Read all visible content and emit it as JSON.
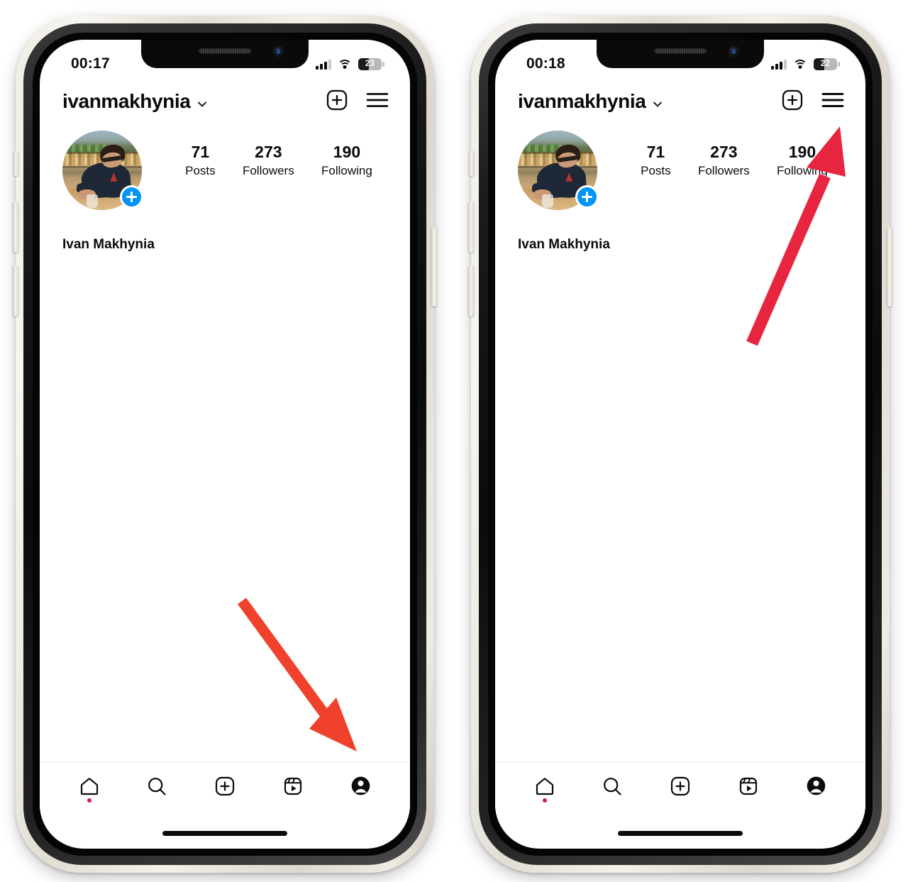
{
  "meta": {
    "app": "Instagram",
    "screens": 2,
    "accent_blue": "#0095f6",
    "arrow_color_left": "#f0412c",
    "arrow_color_right": "#e8253f",
    "badge_red": "#d81b43"
  },
  "phones": [
    {
      "id": "phone-left",
      "status": {
        "clock": "00:17",
        "cellular": "cellular-signal-icon",
        "wifi": "wifi-icon",
        "battery_percent": "23",
        "battery_icon": "battery-icon"
      },
      "header": {
        "username": "ivanmakhynia",
        "chevron": "chevron-down-icon",
        "add_icon": "plus-square-icon",
        "menu_icon": "hamburger-menu-icon"
      },
      "profile": {
        "avatar": "profile-photo",
        "add_story_badge": "plus-circle-icon",
        "full_name": "Ivan Makhynia",
        "stats": [
          {
            "num": "71",
            "label": "Posts"
          },
          {
            "num": "273",
            "label": "Followers"
          },
          {
            "num": "190",
            "label": "Following"
          }
        ]
      },
      "tabbar": [
        {
          "name": "tab-home",
          "icon": "home-icon",
          "badge": true
        },
        {
          "name": "tab-search",
          "icon": "search-icon",
          "badge": false
        },
        {
          "name": "tab-create",
          "icon": "plus-square-icon",
          "badge": false
        },
        {
          "name": "tab-reels",
          "icon": "reels-icon",
          "badge": false
        },
        {
          "name": "tab-profile",
          "icon": "profile-avatar-icon",
          "badge": false
        }
      ],
      "annotation": {
        "type": "arrow",
        "points_to": "tab-profile",
        "color": "#f0412c"
      }
    },
    {
      "id": "phone-right",
      "status": {
        "clock": "00:18",
        "cellular": "cellular-signal-icon",
        "wifi": "wifi-icon",
        "battery_percent": "22",
        "battery_icon": "battery-icon"
      },
      "header": {
        "username": "ivanmakhynia",
        "chevron": "chevron-down-icon",
        "add_icon": "plus-square-icon",
        "menu_icon": "hamburger-menu-icon"
      },
      "profile": {
        "avatar": "profile-photo",
        "add_story_badge": "plus-circle-icon",
        "full_name": "Ivan Makhynia",
        "stats": [
          {
            "num": "71",
            "label": "Posts"
          },
          {
            "num": "273",
            "label": "Followers"
          },
          {
            "num": "190",
            "label": "Following"
          }
        ]
      },
      "tabbar": [
        {
          "name": "tab-home",
          "icon": "home-icon",
          "badge": true
        },
        {
          "name": "tab-search",
          "icon": "search-icon",
          "badge": false
        },
        {
          "name": "tab-create",
          "icon": "plus-square-icon",
          "badge": false
        },
        {
          "name": "tab-reels",
          "icon": "reels-icon",
          "badge": false
        },
        {
          "name": "tab-profile",
          "icon": "profile-avatar-icon",
          "badge": false
        }
      ],
      "annotation": {
        "type": "arrow",
        "points_to": "hamburger-menu-icon",
        "color": "#e8253f"
      }
    }
  ]
}
